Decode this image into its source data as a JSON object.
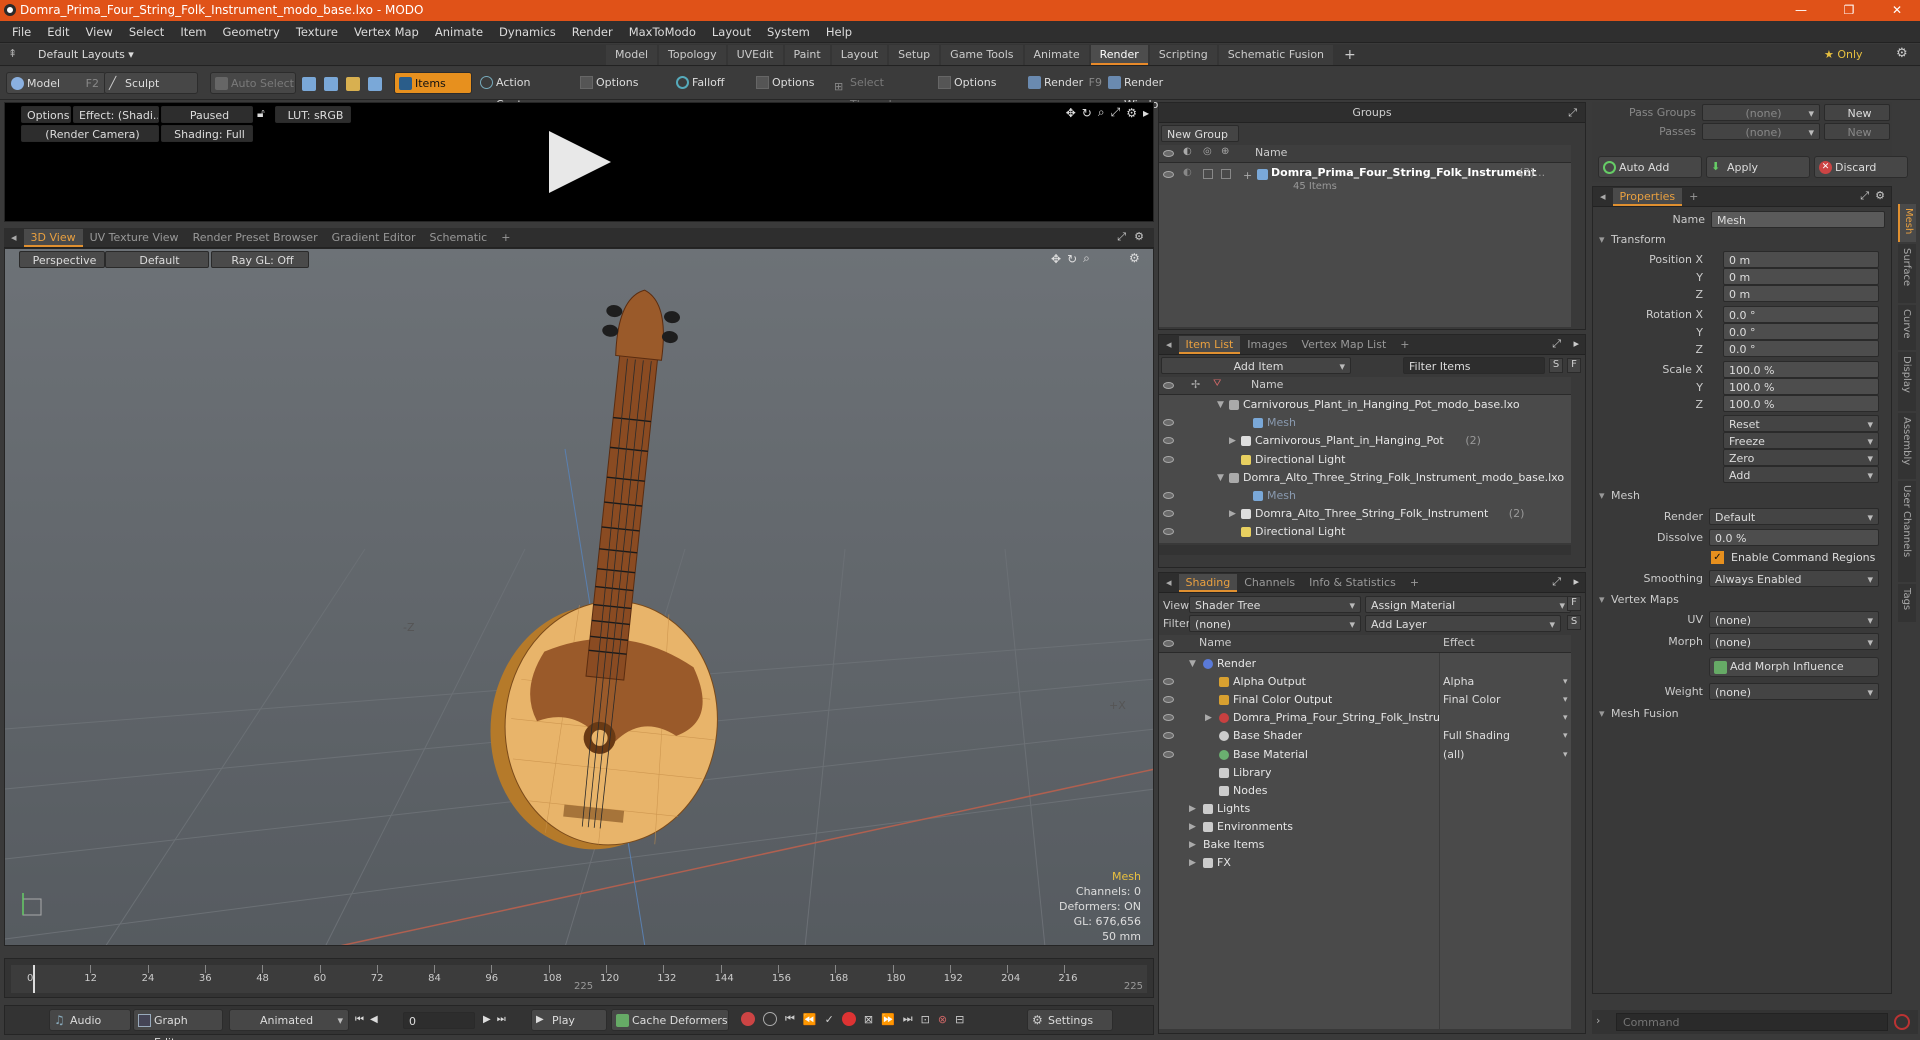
{
  "window": {
    "title": "Domra_Prima_Four_String_Folk_Instrument_modo_base.lxo - MODO",
    "controls": [
      "—",
      "❐",
      "✕"
    ]
  },
  "menu": [
    "File",
    "Edit",
    "View",
    "Select",
    "Item",
    "Geometry",
    "Texture",
    "Vertex Map",
    "Animate",
    "Dynamics",
    "Render",
    "MaxToModo",
    "Layout",
    "System",
    "Help"
  ],
  "layouts": {
    "preset": "Default Layouts ▾",
    "tabs": [
      "Model",
      "Topology",
      "UVEdit",
      "Paint",
      "Layout",
      "Setup",
      "Game Tools",
      "Animate",
      "Render",
      "Scripting",
      "Schematic Fusion"
    ],
    "active": "Render",
    "add": "+",
    "only": "★ Only"
  },
  "toolbar": {
    "model": "Model",
    "model_key": "F2",
    "sculpt": "Sculpt",
    "auto_select": "Auto Select",
    "items": "Items",
    "action_center": "Action Center",
    "options1": "Options",
    "falloff": "Falloff",
    "options2": "Options",
    "select_through": "Select Through",
    "options3": "Options",
    "render": "Render",
    "render_key": "F9",
    "render_window": "Render Window"
  },
  "render_preview": {
    "options": "Options",
    "effect": "Effect: (Shadi...",
    "paused": "Paused",
    "lut": "LUT: sRGB",
    "camera": "(Render Camera)",
    "shading": "Shading: Full"
  },
  "viewport": {
    "tabs": [
      "3D View",
      "UV Texture View",
      "Render Preset Browser",
      "Gradient Editor",
      "Schematic"
    ],
    "active": "3D View",
    "perspective": "Perspective",
    "default": "Default",
    "raygl": "Ray GL: Off",
    "axis_z": "-Z",
    "axis_x": "+X",
    "info": {
      "label": "Mesh",
      "channels": "Channels: 0",
      "deformers": "Deformers: ON",
      "gl": "GL: 676,656",
      "focal": "50 mm"
    }
  },
  "timeline": {
    "ticks": [
      "0",
      "12",
      "24",
      "36",
      "48",
      "60",
      "72",
      "84",
      "96",
      "108",
      "120",
      "132",
      "144",
      "156",
      "168",
      "180",
      "192",
      "204",
      "216"
    ],
    "mid_label": "225",
    "end_label": "225"
  },
  "transport": {
    "audio": "Audio",
    "graph_editor": "Graph Editor",
    "animated": "Animated",
    "frame": "0",
    "play": "Play",
    "cache": "Cache Deformers",
    "settings": "Settings"
  },
  "groups": {
    "title": "Groups",
    "new_group": "New Group",
    "col_name": "Name",
    "item_name": "Domra_Prima_Four_String_Folk_Instrument",
    "item_count": "(3)...",
    "item_sub": "45 Items"
  },
  "item_list": {
    "tabs": [
      "Item List",
      "Images",
      "Vertex Map List"
    ],
    "active": "Item List",
    "add_item": "Add Item",
    "filter": "Filter Items",
    "col_name": "Name",
    "rows": [
      {
        "text": "Carnivorous_Plant_in_Hanging_Pot_modo_base.lxo",
        "indent": 0,
        "kind": "scene",
        "count": ""
      },
      {
        "text": "Mesh",
        "indent": 2,
        "kind": "mesh",
        "count": ""
      },
      {
        "text": "Carnivorous_Plant_in_Hanging_Pot",
        "indent": 1,
        "kind": "group",
        "count": "(2)"
      },
      {
        "text": "Directional Light",
        "indent": 1,
        "kind": "light",
        "count": ""
      },
      {
        "text": "Domra_Alto_Three_String_Folk_Instrument_modo_base.lxo",
        "indent": 0,
        "kind": "scene",
        "count": ""
      },
      {
        "text": "Mesh",
        "indent": 2,
        "kind": "mesh",
        "count": ""
      },
      {
        "text": "Domra_Alto_Three_String_Folk_Instrument",
        "indent": 1,
        "kind": "group",
        "count": "(2)"
      },
      {
        "text": "Directional Light",
        "indent": 1,
        "kind": "light",
        "count": ""
      }
    ]
  },
  "shading": {
    "tabs": [
      "Shading",
      "Channels",
      "Info & Statistics"
    ],
    "active": "Shading",
    "view_label": "View",
    "view_value": "Shader Tree",
    "assign_material": "Assign Material",
    "filter_label": "Filter",
    "filter_value": "(none)",
    "add_layer": "Add Layer",
    "col_name": "Name",
    "col_effect": "Effect",
    "rows": [
      {
        "name": "Render",
        "effect": "",
        "indent": 0
      },
      {
        "name": "Alpha Output",
        "effect": "Alpha",
        "indent": 1
      },
      {
        "name": "Final Color Output",
        "effect": "Final Color",
        "indent": 1
      },
      {
        "name": "Domra_Prima_Four_String_Folk_Instru ...",
        "effect": "",
        "indent": 1
      },
      {
        "name": "Base Shader",
        "effect": "Full Shading",
        "indent": 1
      },
      {
        "name": "Base Material",
        "effect": "(all)",
        "indent": 1
      },
      {
        "name": "Library",
        "effect": "",
        "indent": 1
      },
      {
        "name": "Nodes",
        "effect": "",
        "indent": 1
      },
      {
        "name": "Lights",
        "effect": "",
        "indent": 0
      },
      {
        "name": "Environments",
        "effect": "",
        "indent": 0
      },
      {
        "name": "Bake Items",
        "effect": "",
        "indent": 0
      },
      {
        "name": "FX",
        "effect": "",
        "indent": 0
      }
    ]
  },
  "passes": {
    "pass_groups_label": "Pass Groups",
    "pass_groups_value": "(none)",
    "passes_label": "Passes",
    "passes_value": "(none)",
    "new": "New",
    "auto_add": "Auto Add",
    "apply": "Apply",
    "discard": "Discard"
  },
  "properties": {
    "tab": "Properties",
    "name_label": "Name",
    "name_value": "Mesh",
    "transform": "Transform",
    "position_label": "Position X",
    "rotation_label": "Rotation X",
    "scale_label": "Scale X",
    "y": "Y",
    "z": "Z",
    "position": [
      "0 m",
      "0 m",
      "0 m"
    ],
    "rotation": [
      "0.0 °",
      "0.0 °",
      "0.0 °"
    ],
    "scale": [
      "100.0 %",
      "100.0 %",
      "100.0 %"
    ],
    "reset": "Reset",
    "freeze": "Freeze",
    "zero": "Zero",
    "add": "Add",
    "mesh_section": "Mesh",
    "render_label": "Render",
    "render_value": "Default",
    "dissolve_label": "Dissolve",
    "dissolve_value": "0.0 %",
    "enable_cmd": "Enable Command Regions",
    "smoothing_label": "Smoothing",
    "smoothing_value": "Always Enabled",
    "vertex_maps": "Vertex Maps",
    "uv_label": "UV",
    "uv_value": "(none)",
    "morph_label": "Morph",
    "morph_value": "(none)",
    "add_morph": "Add Morph Influence",
    "weight_label": "Weight",
    "weight_value": "(none)",
    "mesh_fusion": "Mesh Fusion",
    "side_tabs": [
      "Mesh",
      "Surface",
      "Curve",
      "Display",
      "Assembly",
      "User Channels",
      "Tags"
    ]
  },
  "command": {
    "placeholder": "Command"
  },
  "colors": {
    "titlebar": "#e05218",
    "accent": "#e7901e",
    "wood_body": "#e8b46a",
    "wood_neck": "#8a4b22"
  }
}
